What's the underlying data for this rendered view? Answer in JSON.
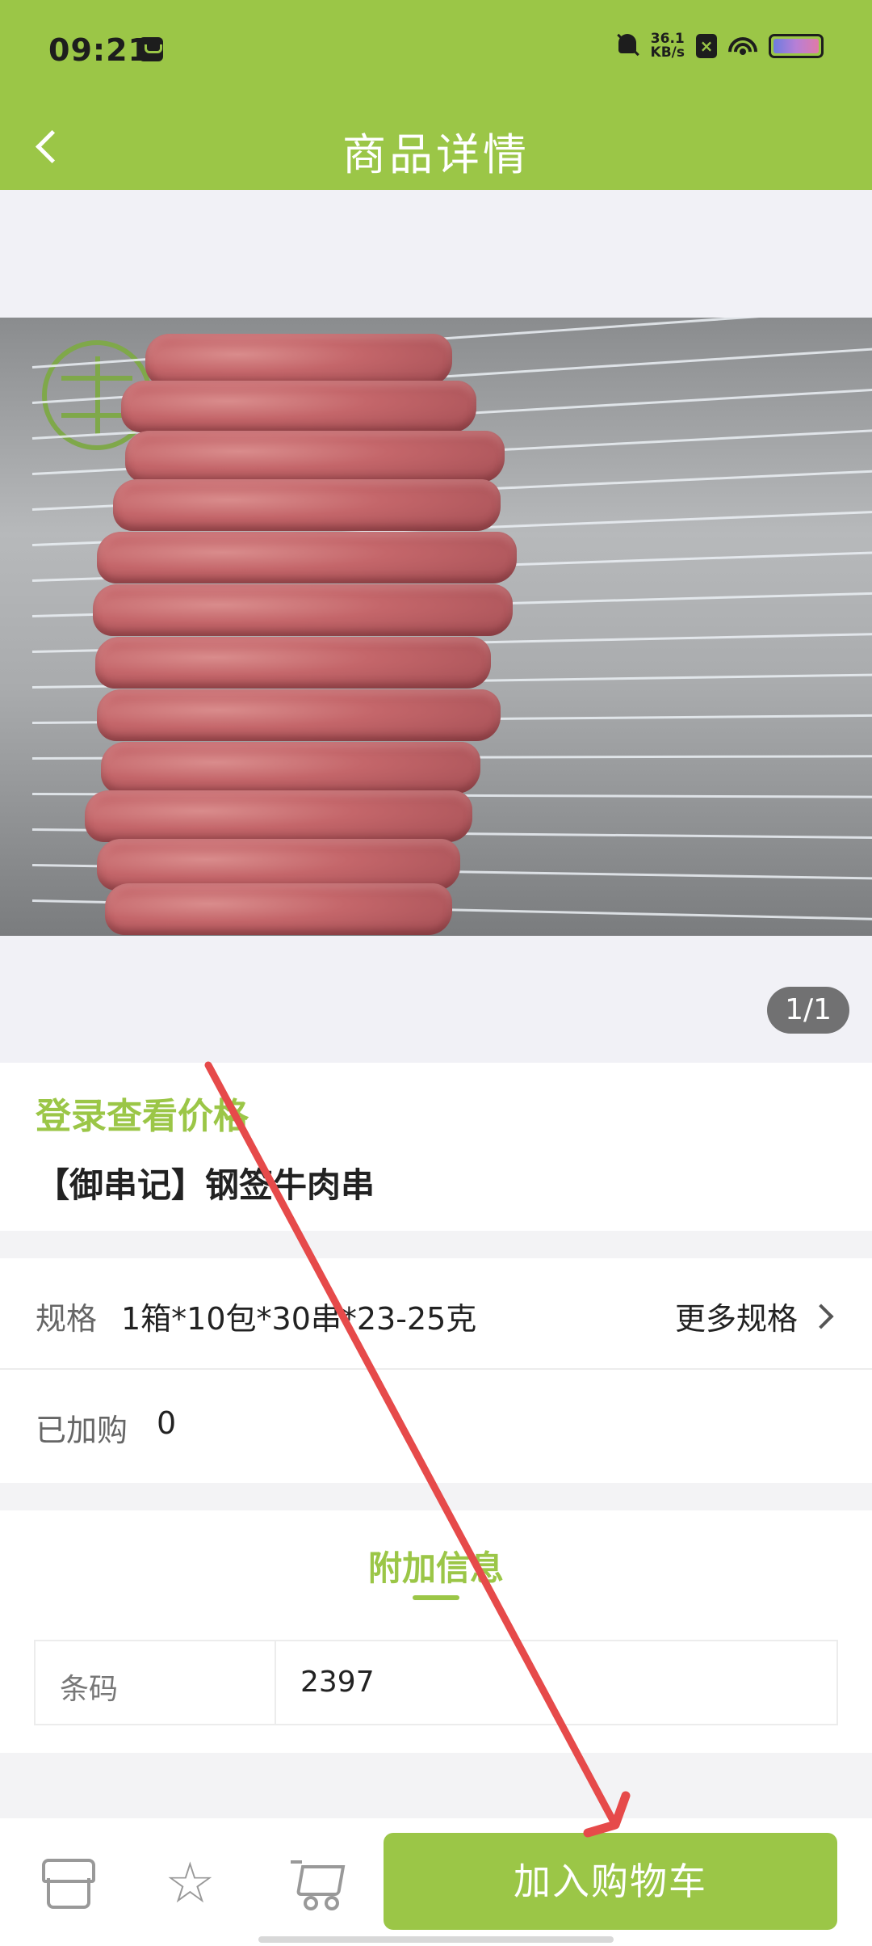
{
  "status_bar": {
    "time": "09:21",
    "network_speed_value": "36.1",
    "network_speed_unit": "KB/s"
  },
  "header": {
    "title": "商品详情"
  },
  "gallery": {
    "counter": "1/1"
  },
  "product": {
    "price_prompt": "登录查看价格",
    "name": "【御串记】钢签牛肉串"
  },
  "spec": {
    "label": "规格",
    "value": "1箱*10包*30串*23-25克",
    "more_label": "更多规格"
  },
  "added": {
    "label": "已加购",
    "value": "0"
  },
  "extra_info": {
    "title": "附加信息",
    "rows": [
      {
        "key": "条码",
        "value": "2397"
      }
    ]
  },
  "bottom_bar": {
    "add_to_cart_label": "加入购物车",
    "icons": [
      "store-icon",
      "star-icon",
      "cart-icon"
    ]
  },
  "colors": {
    "brand_green": "#9bc647",
    "annotation_red": "#e64a4a"
  }
}
